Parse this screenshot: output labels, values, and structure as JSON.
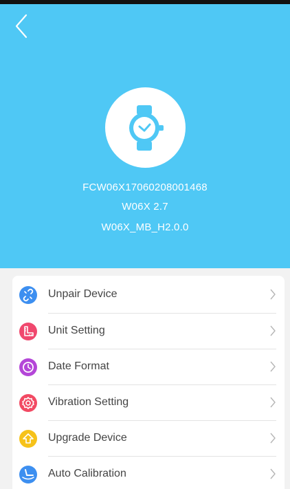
{
  "header": {
    "serial": "FCW06X17060208001468",
    "model_version": "W06X 2.7",
    "hardware_version": "W06X_MB_H2.0.0",
    "background_color": "#4fc8f5",
    "back_icon": "chevron-left-icon",
    "device_icon": "watch-icon"
  },
  "menu": {
    "items": [
      {
        "label": "Unpair Device",
        "icon": "unlink-icon",
        "color": "#3d8ff0"
      },
      {
        "label": "Unit Setting",
        "icon": "ruler-icon",
        "color": "#f0486e"
      },
      {
        "label": "Date Format",
        "icon": "clock-icon",
        "color": "#b446d8"
      },
      {
        "label": "Vibration Setting",
        "icon": "gear-icon",
        "color": "#f24a63"
      },
      {
        "label": "Upgrade Device",
        "icon": "upgrade-arrow-icon",
        "color": "#f6c21a"
      },
      {
        "label": "Auto Calibration",
        "icon": "calibration-icon",
        "color": "#3d8ff0"
      }
    ]
  }
}
